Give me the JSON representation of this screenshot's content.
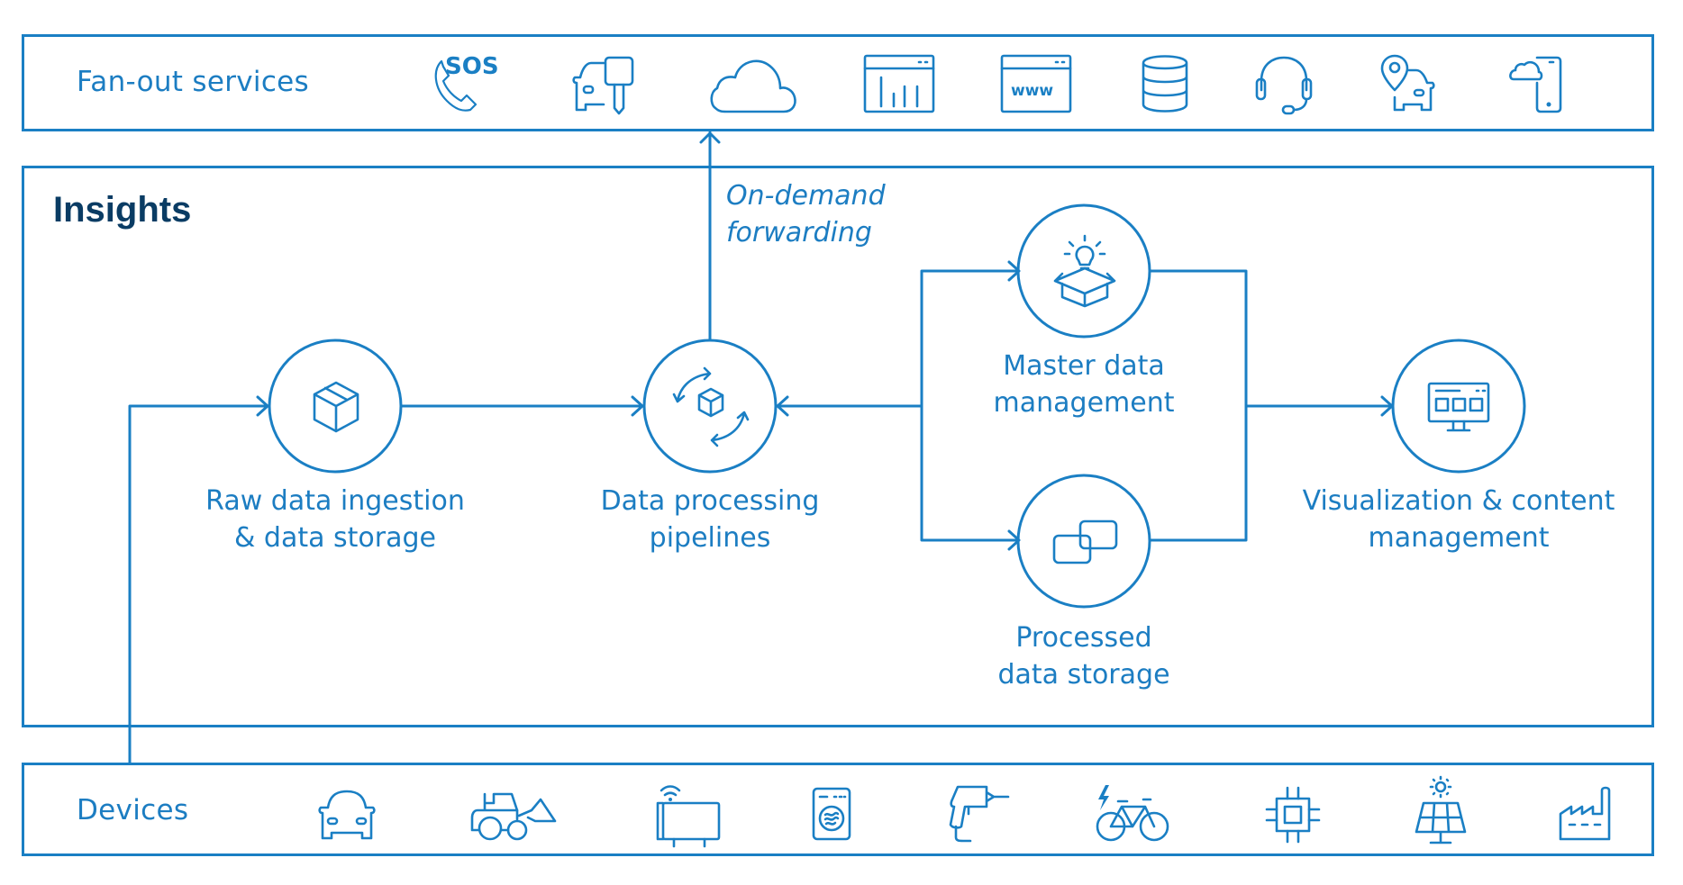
{
  "colors": {
    "accent": "#1a7fc4",
    "heading": "#0a3c64",
    "background": "#ffffff"
  },
  "fanout": {
    "label": "Fan-out services",
    "icons": [
      "sos-call-icon",
      "car-key-icon",
      "cloud-icon",
      "dashboard-chart-icon",
      "website-www-icon",
      "database-icon",
      "headset-icon",
      "car-location-icon",
      "cloud-mobile-icon"
    ],
    "sos_text": "SOS",
    "www_text": "www"
  },
  "insights": {
    "title": "Insights",
    "forwarding_note": [
      "On-demand",
      "forwarding"
    ],
    "nodes": [
      {
        "id": "raw-data",
        "icon": "box-icon",
        "label": [
          "Raw data ingestion",
          "& data storage"
        ]
      },
      {
        "id": "data-processing",
        "icon": "cycle-box-icon",
        "label": [
          "Data processing",
          "pipelines"
        ]
      },
      {
        "id": "master-data",
        "icon": "idea-box-icon",
        "label": [
          "Master data",
          "management"
        ]
      },
      {
        "id": "processed-storage",
        "icon": "linked-squares-icon",
        "label": [
          "Processed",
          "data storage"
        ]
      },
      {
        "id": "visualization",
        "icon": "monitor-dashboard-icon",
        "label": [
          "Visualization & content",
          "management"
        ]
      }
    ]
  },
  "devices": {
    "label": "Devices",
    "icons": [
      "car-icon",
      "wheel-loader-icon",
      "connected-heater-icon",
      "washing-machine-icon",
      "drill-icon",
      "ebike-icon",
      "chip-icon",
      "solar-panel-icon",
      "factory-icon"
    ]
  }
}
